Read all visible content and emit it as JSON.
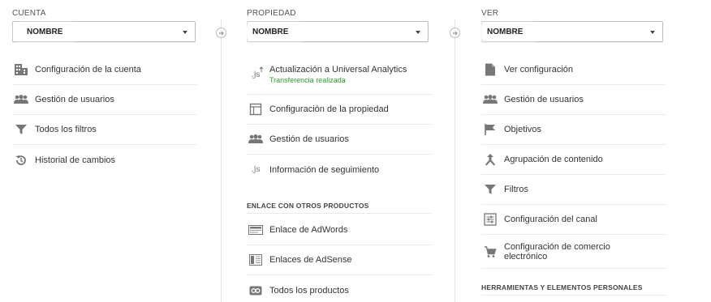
{
  "columns": {
    "cuenta": {
      "label": "CUENTA",
      "select_value": "NOMBRE",
      "items": [
        {
          "label": "Configuración de la cuenta"
        },
        {
          "label": "Gestión de usuarios"
        },
        {
          "label": "Todos los filtros"
        },
        {
          "label": "Historial de cambios"
        }
      ]
    },
    "propiedad": {
      "label": "PROPIEDAD",
      "select_value": "NOMBRE",
      "items": [
        {
          "label": "Actualización a Universal Analytics",
          "sub": "Transferencia realizada"
        },
        {
          "label": "Configuración de la propiedad"
        },
        {
          "label": "Gestión de usuarios"
        },
        {
          "label": "Información de seguimiento"
        }
      ],
      "section_title": "ENLACE CON OTROS PRODUCTOS",
      "section_items": [
        {
          "label": "Enlace de AdWords"
        },
        {
          "label": "Enlaces de AdSense"
        },
        {
          "label": "Todos los productos"
        }
      ]
    },
    "ver": {
      "label": "VER",
      "select_value": "NOMBRE",
      "items": [
        {
          "label": "Ver configuración"
        },
        {
          "label": "Gestión de usuarios"
        },
        {
          "label": "Objetivos"
        },
        {
          "label": "Agrupación de contenido"
        },
        {
          "label": "Filtros"
        },
        {
          "label": "Configuración del canal"
        },
        {
          "label": "Configuración de comercio electrónico"
        }
      ],
      "section_title": "HERRAMIENTAS Y ELEMENTOS PERSONALES"
    }
  },
  "icons": {
    "js_text": ".js"
  },
  "colors": {
    "success_text": "#2e9a2e",
    "icon_gray": "#777777"
  }
}
